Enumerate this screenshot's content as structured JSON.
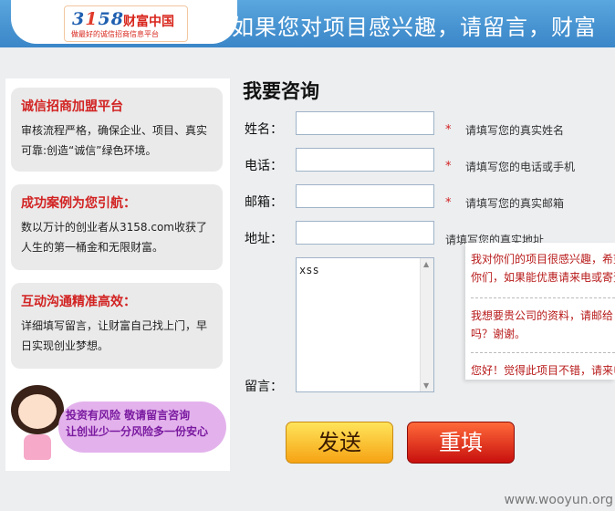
{
  "header": {
    "logo_number": "3158",
    "logo_brand": "财富中国",
    "logo_slogan": "做最好的诚信招商信息平台",
    "banner": "如果您对项目感兴趣，请留言，财富"
  },
  "sidebar": {
    "cards": [
      {
        "title": "诚信招商加盟平台",
        "text": "审核流程严格，确保企业、项目、真实可靠:创造“诚信”绿色环境。"
      },
      {
        "title": "成功案例为您引航：",
        "text": "数以万计的创业者从3158.com收获了人生的第一桶金和无限财富。"
      },
      {
        "title": "互动沟通精准高效：",
        "text": "详细填写留言，让财富自己找上门，早日实现创业梦想。"
      }
    ],
    "promo": {
      "line1": "投资有风险 敬请留言咨询",
      "line2": "让创业少一分风险多一份安心"
    }
  },
  "form": {
    "title": "我要咨询",
    "fields": [
      {
        "label": "姓名：",
        "value": "",
        "required": "*",
        "hint": "请填写您的真实姓名"
      },
      {
        "label": "电话：",
        "value": "",
        "required": "*",
        "hint": "请填写您的电话或手机"
      },
      {
        "label": "邮箱：",
        "value": "",
        "required": "*",
        "hint": "请填写您的真实邮箱"
      },
      {
        "label": "地址：",
        "value": "",
        "hint": "请填写您的真实地址"
      }
    ],
    "message": {
      "label": "留言：",
      "value": "xss"
    },
    "buttons": {
      "send": "发送",
      "reset": "重填"
    }
  },
  "suggestions": [
    {
      "line1": "我对你们的项目很感兴趣，希望",
      "line2": "你们，如果能优惠请来电或寄资"
    },
    {
      "line1": "我想要贵公司的资料，请邮给",
      "line2": "吗？谢谢。"
    },
    {
      "line1": "您好！觉得此项目不错，请来电"
    }
  ],
  "watermark": "www.wooyun.org"
}
